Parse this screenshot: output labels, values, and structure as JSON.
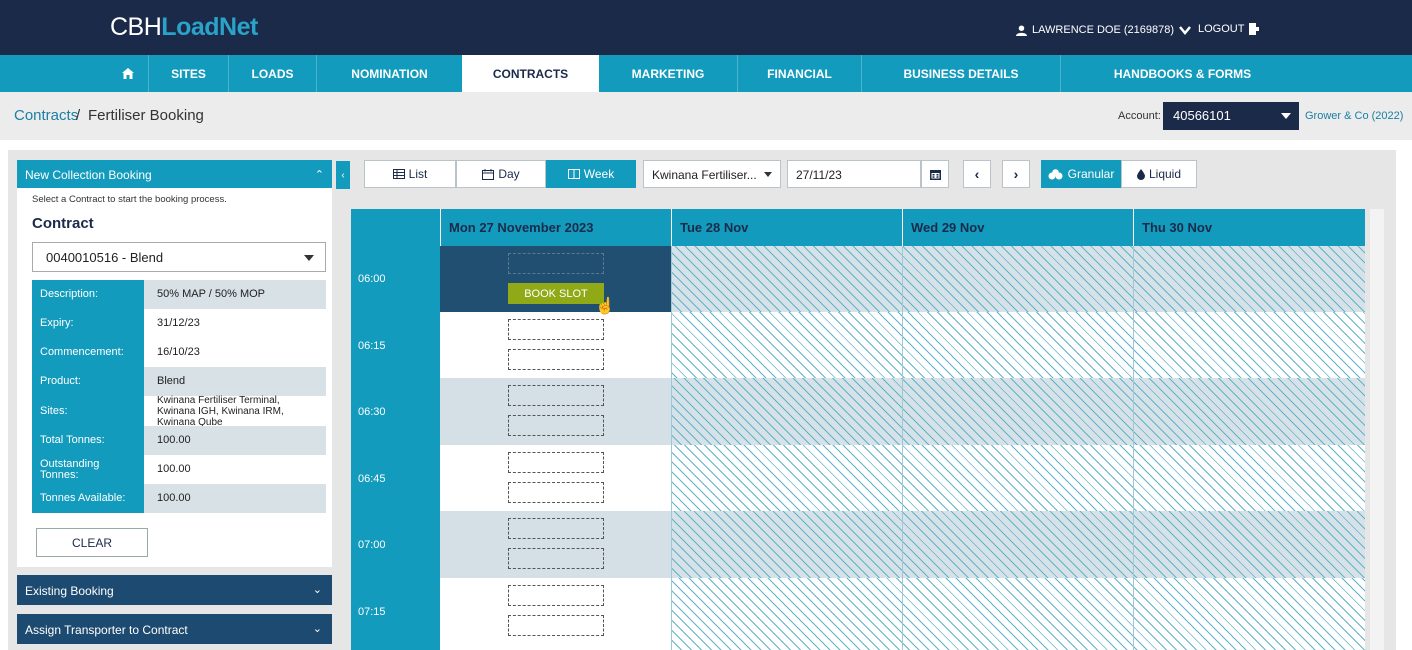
{
  "header": {
    "logo_part1": "CBH",
    "logo_part2": "LoadNet",
    "user_label": "LAWRENCE DOE (2169878)",
    "logout_label": "LOGOUT"
  },
  "nav": {
    "home_icon": "home-icon",
    "items": [
      "SITES",
      "LOADS",
      "NOMINATION",
      "CONTRACTS",
      "MARKETING",
      "FINANCIAL",
      "BUSINESS DETAILS",
      "HANDBOOKS & FORMS"
    ],
    "active": "CONTRACTS"
  },
  "breadcrumb": {
    "link": "Contracts",
    "separator": "/",
    "current": "Fertiliser Booking",
    "account_label": "Account:",
    "account_value": "40566101",
    "account_name": "Grower & Co (2022)"
  },
  "panel": {
    "title": "New Collection Booking",
    "hint": "Select a Contract to start the booking process.",
    "contract_label": "Contract",
    "contract_value": "0040010516 - Blend",
    "details": [
      {
        "key": "Description:",
        "value": "50% MAP / 50% MOP"
      },
      {
        "key": "Expiry:",
        "value": "31/12/23"
      },
      {
        "key": "Commencement:",
        "value": "16/10/23"
      },
      {
        "key": "Product:",
        "value": "Blend"
      },
      {
        "key": "Sites:",
        "value": "Kwinana Fertiliser Terminal, Kwinana IGH, Kwinana IRM, Kwinana Qube"
      },
      {
        "key": "Total Tonnes:",
        "value": "100.00"
      },
      {
        "key": "Outstanding Tonnes:",
        "value": "100.00"
      },
      {
        "key": "Tonnes Available:",
        "value": "100.00"
      }
    ],
    "clear_label": "CLEAR",
    "existing_booking": "Existing Booking",
    "assign_transporter": "Assign Transporter to Contract"
  },
  "toolbar": {
    "list_label": "List",
    "day_label": "Day",
    "week_label": "Week",
    "site_value": "Kwinana Fertiliser...",
    "date_value": "27/11/23",
    "granular_label": "Granular",
    "liquid_label": "Liquid"
  },
  "calendar": {
    "columns": [
      "Mon 27 November 2023",
      "Tue 28 Nov",
      "Wed 29 Nov",
      "Thu 30 Nov"
    ],
    "times": [
      "06:00",
      "06:15",
      "06:30",
      "06:45",
      "07:00",
      "07:15"
    ],
    "book_slot_label": "BOOK SLOT"
  },
  "colors": {
    "navy": "#1c2a4a",
    "accent": "#139bbd",
    "book_green": "#8faa16"
  }
}
